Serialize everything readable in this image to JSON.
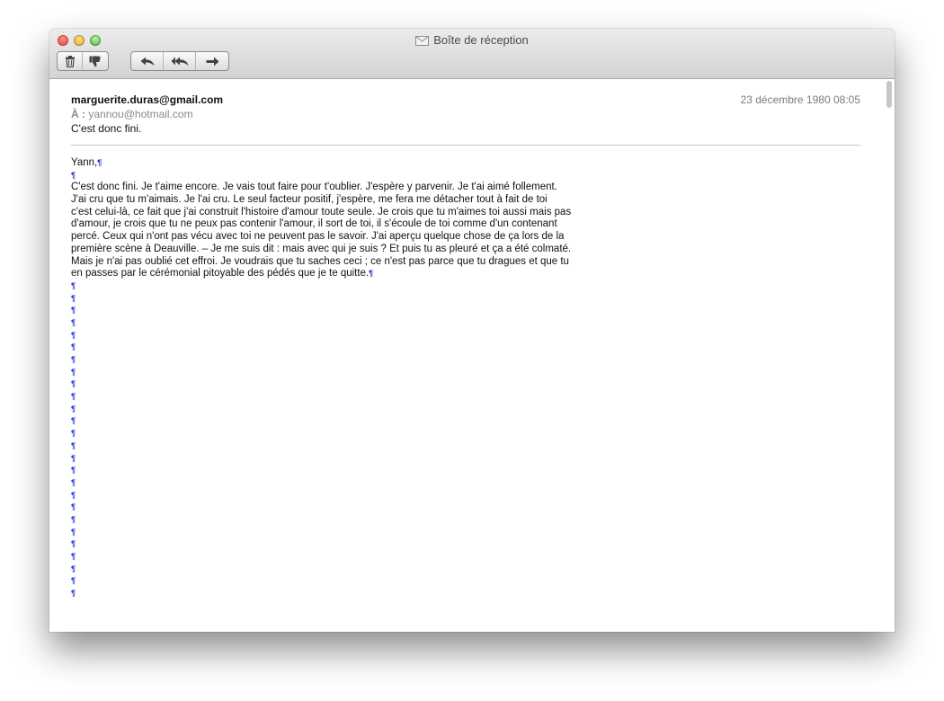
{
  "window": {
    "title": "Boîte de réception"
  },
  "toolbar": {
    "delete_icon": "trash-icon",
    "junk_icon": "thumbs-down-icon",
    "reply_icon": "reply-arrow-icon",
    "reply_all_icon": "reply-all-arrow-icon",
    "forward_icon": "forward-arrow-icon"
  },
  "message": {
    "from": "marguerite.duras@gmail.com",
    "date": "23 décembre 1980 08:05",
    "to_label": "À :",
    "to": "yannou@hotmail.com",
    "subject": "C'est donc fini.",
    "greeting": "Yann,",
    "body_lines": [
      "C'est donc fini. Je t'aime encore. Je vais tout faire pour t'oublier. J'espère y parvenir. Je t'ai aimé follement.",
      "J'ai cru que tu m'aimais. Je l'ai cru. Le seul facteur positif, j'espère, me fera me détacher tout à fait de toi",
      "c'est celui-là, ce fait que j'ai construit l'histoire d'amour toute seule. Je crois que tu m'aimes toi aussi mais pas",
      "d'amour, je crois que tu ne peux pas contenir l'amour, il sort de toi, il s'écoule de toi comme d'un contenant",
      "percé. Ceux qui n'ont pas vécu avec toi ne peuvent pas le savoir. J'ai aperçu quelque chose de ça lors de la",
      "première scène à Deauville. – Je me suis dit : mais avec qui je suis ? Et puis tu as pleuré et ça a été colmaté.",
      "Mais je n'ai pas oublié cet effroi. Je voudrais que tu saches ceci ; ce n'est pas parce que tu dragues et que tu",
      "en passes par le cérémonial pitoyable des pédés que je te quitte."
    ],
    "pilcrow": "¶",
    "empty_paragraphs": 26
  },
  "colors": {
    "pilcrow": "#1b2bd6",
    "meta_grey": "#7a7a7a"
  }
}
